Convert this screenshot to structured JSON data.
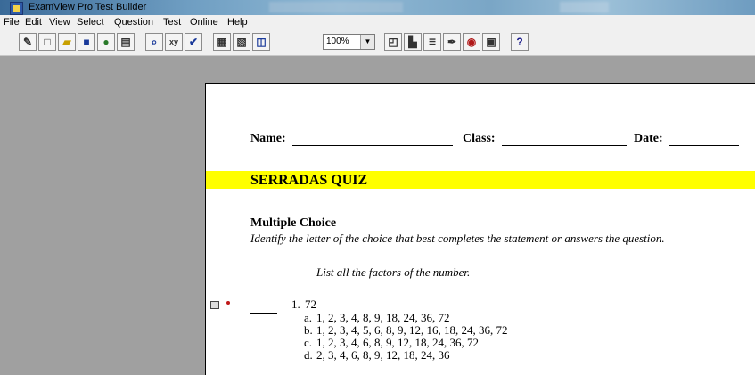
{
  "window": {
    "title": "ExamView Pro Test Builder"
  },
  "menu": [
    "File",
    "Edit",
    "View",
    "Select",
    "Question",
    "Test",
    "Online",
    "Help"
  ],
  "toolbar": {
    "zoom_value": "100%",
    "icons": [
      "new-test-wizard-icon",
      "new-document-icon",
      "open-folder-icon",
      "save-icon",
      "publish-icon",
      "print-icon",
      "find-icon",
      "spelling-icon",
      "check-spelling-icon",
      "calculator-icon",
      "page-setup-icon",
      "preview-icon",
      "layout-icon",
      "edit-icon",
      "multiple-choice-icon",
      "answer-key-icon",
      "settings-icon",
      "review-icon",
      "options-icon",
      "help-icon"
    ]
  },
  "document": {
    "name_label": "Name:",
    "class_label": "Class:",
    "date_label": "Date:",
    "quiz_title": "SERRADAS QUIZ",
    "section_title": "Multiple Choice",
    "instructions": "Identify the letter of the choice that best completes the statement or answers the question.",
    "question_intro": "List all the factors of the number.",
    "question": {
      "number": "1.",
      "text": "72",
      "choices": [
        {
          "letter": "a.",
          "text": "1, 2, 3, 4, 8, 9, 18, 24, 36, 72"
        },
        {
          "letter": "b.",
          "text": "1, 2, 3, 4, 5, 6, 8, 9, 12, 16, 18, 24, 36, 72"
        },
        {
          "letter": "c.",
          "text": "1, 2, 3, 4, 6, 8, 9, 12, 18, 24, 36, 72"
        },
        {
          "letter": "d.",
          "text": "2, 3, 4, 6, 8, 9, 12, 18, 24, 36"
        }
      ]
    }
  }
}
